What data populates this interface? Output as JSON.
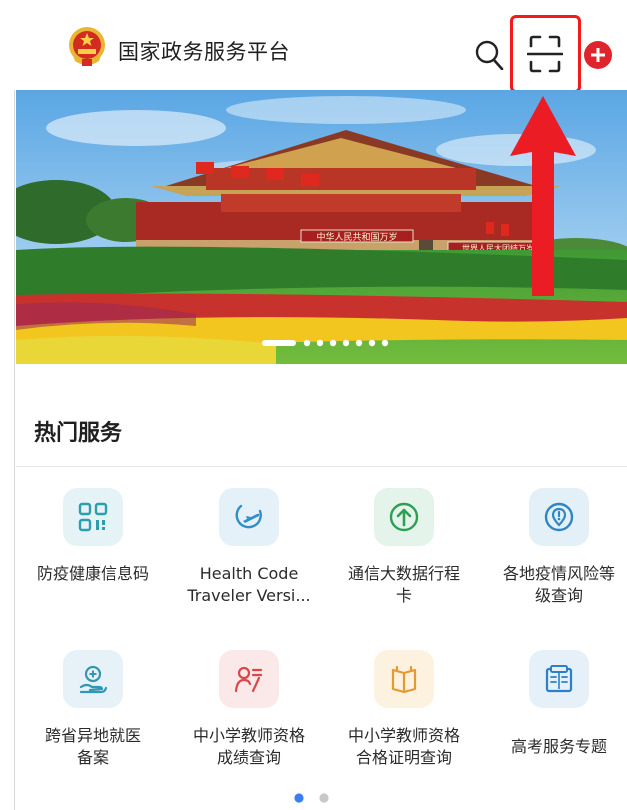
{
  "header": {
    "title": "国家政务服务平台",
    "icons": {
      "emblem": "national-emblem-icon",
      "search": "search-icon",
      "scan": "scan-icon",
      "add": "add-icon"
    }
  },
  "banner": {
    "image": "tiananmen-gate-photo",
    "carousel_active_index": 0,
    "carousel_count": 8,
    "gate_signs": [
      "中华人民共和国万岁",
      "世界人民大团结万岁"
    ]
  },
  "annotation": {
    "highlight_color": "#f21a1a",
    "target": "scan-icon"
  },
  "hot_services": {
    "title": "热门服务",
    "items": [
      {
        "lines": [
          "防疫健康信息码"
        ],
        "icon": "qr-code-icon",
        "bg": "#e6f3f6",
        "color": "#2b9fb0"
      },
      {
        "lines": [
          "Health Code",
          "Traveler Versi..."
        ],
        "icon": "plane-icon",
        "bg": "#e5f1f8",
        "color": "#2f8fc8"
      },
      {
        "lines": [
          "通信大数据行程",
          "卡"
        ],
        "icon": "upload-arrow-icon",
        "bg": "#e5f4ea",
        "color": "#2e9e57"
      },
      {
        "lines": [
          "各地疫情风险等",
          "级查询"
        ],
        "icon": "location-shield-icon",
        "bg": "#e4f0f8",
        "color": "#2f86c4"
      },
      {
        "lines": [
          "跨省异地就医",
          "备案"
        ],
        "icon": "medical-hand-icon",
        "bg": "#e6f2f7",
        "color": "#3296b5"
      },
      {
        "lines": [
          "中小学教师资格",
          "成绩查询"
        ],
        "icon": "teacher-score-icon",
        "bg": "#fbe9e9",
        "color": "#d9474b"
      },
      {
        "lines": [
          "中小学教师资格",
          "合格证明查询"
        ],
        "icon": "certificate-book-icon",
        "bg": "#fdf1df",
        "color": "#e59a2f"
      },
      {
        "lines": [
          "高考服务专题"
        ],
        "icon": "exam-book-icon",
        "bg": "#e5f0f9",
        "color": "#2d80c7"
      }
    ]
  },
  "pager": {
    "active_index": 0,
    "count": 2,
    "active_color": "#3a7ff2",
    "inactive_color": "#c8c8c8"
  }
}
